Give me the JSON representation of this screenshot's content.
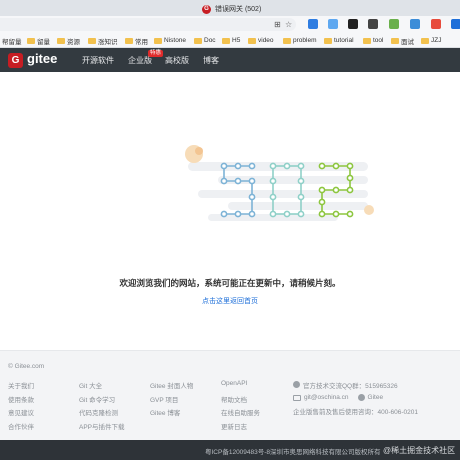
{
  "browser": {
    "tab_title": "错误网关 (502)",
    "tab_favicon": "G",
    "bookmarks": [
      "帮留量",
      "留量",
      "资源",
      "涨知识",
      "常用",
      "Nistone",
      "Doc",
      "H5",
      "video",
      "problem",
      "tutorial",
      "tool",
      "面试",
      "JZJ"
    ]
  },
  "header": {
    "logo_text": "gitee",
    "nav": [
      "开源软件",
      "企业版",
      "高校版",
      "博客"
    ],
    "hot_badge": "特惠"
  },
  "main": {
    "headline": "欢迎浏览我们的网站，系统可能正在更新中，请稍候片刻。",
    "home_link": "点击这里返回首页",
    "art_digits": [
      "5",
      "0",
      "2"
    ]
  },
  "footer": {
    "copyright": "© Gitee.com",
    "col1": [
      "关于我们",
      "使用条款",
      "意见建议",
      "合作伙伴"
    ],
    "col2": [
      "Git 大全",
      "Git 命令学习",
      "代码克隆检测",
      "APP与插件下载"
    ],
    "col3": [
      "Gitee 封面人物",
      "GVP 项目",
      "Gitee 博客"
    ],
    "col4": [
      "OpenAPI",
      "帮助文档",
      "在线自助服务",
      "更新日志"
    ],
    "qq": "官方技术交流QQ群：515965326",
    "email": "git@oschina.cn",
    "weibo": "Gitee",
    "phone": "企业版售前及售后使用咨询：400-606-0201",
    "icp": "粤ICP备12009483号-8深圳市奥思网络科技有限公司版权所有",
    "watermark": "@稀土掘金技术社区"
  },
  "colors": {
    "brand": "#c71d23",
    "header_bg": "#333a40",
    "link": "#1e6fd9",
    "digit_5": "#7db3d6",
    "digit_0": "#8fd0c8",
    "digit_2": "#8dc63f"
  }
}
